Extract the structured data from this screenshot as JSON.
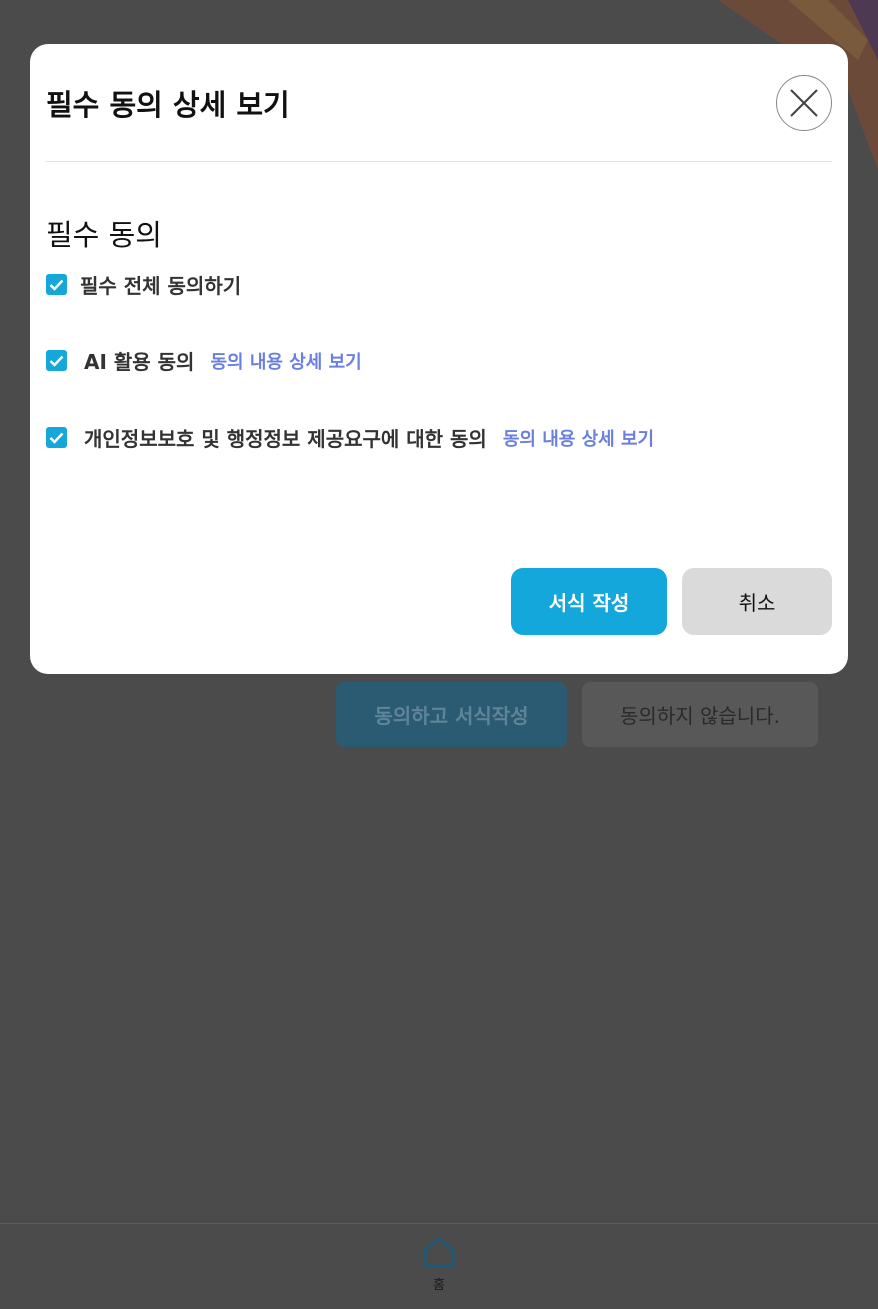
{
  "background": {
    "agree_button": "동의하고 서식작성",
    "decline_button": "동의하지 않습니다."
  },
  "bottom_nav": {
    "home_label": "홈",
    "home_icon": "home-icon"
  },
  "modal": {
    "title": "필수 동의 상세 보기",
    "close_icon": "close-icon",
    "section_title": "필수 동의",
    "items": [
      {
        "label": "필수 전체 동의하기",
        "checked": true,
        "link": ""
      },
      {
        "label": "AI 활용 동의",
        "checked": true,
        "link": "동의 내용 상세 보기"
      },
      {
        "label": "개인정보보호 및 행정정보 제공요구에 대한 동의",
        "checked": true,
        "link": "동의 내용 상세 보기"
      }
    ],
    "primary_button": "서식 작성",
    "secondary_button": "취소"
  },
  "colors": {
    "accent": "#13a7dc",
    "link": "#6a7fe0",
    "overlay_background": "#4b4b4b"
  }
}
